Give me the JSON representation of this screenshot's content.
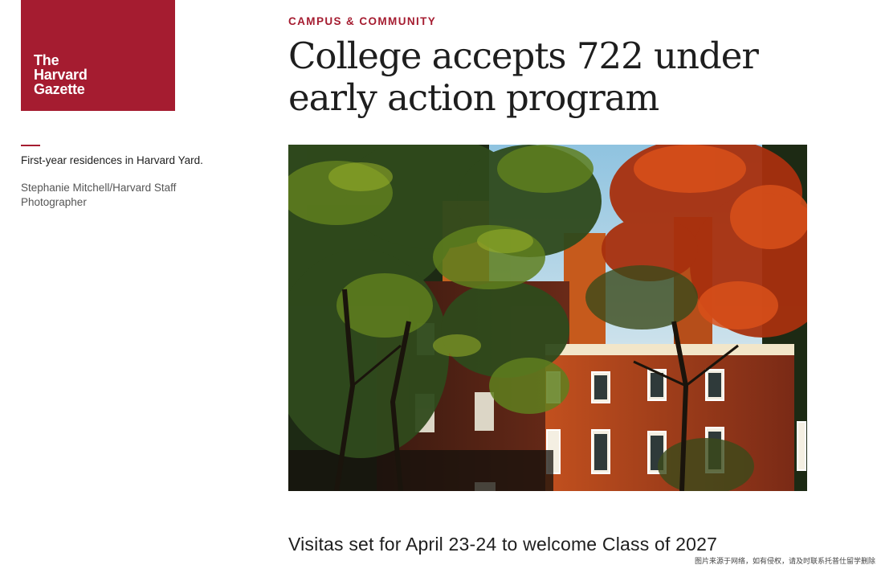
{
  "brand": {
    "logo_lines": [
      "The",
      "Harvard",
      "Gazette"
    ],
    "accent_color": "#a51c30"
  },
  "article": {
    "kicker": "CAMPUS & COMMUNITY",
    "headline": "College accepts 722 under early action program",
    "subheadline": "Visitas set for April 23-24 to welcome Class of 2027"
  },
  "photo": {
    "caption": "First-year residences in Harvard Yard.",
    "credit": "Stephanie Mitchell/Harvard Staff Photographer"
  },
  "watermark": "图片来源于网络，如有侵权，请及时联系托普仕留学删除"
}
